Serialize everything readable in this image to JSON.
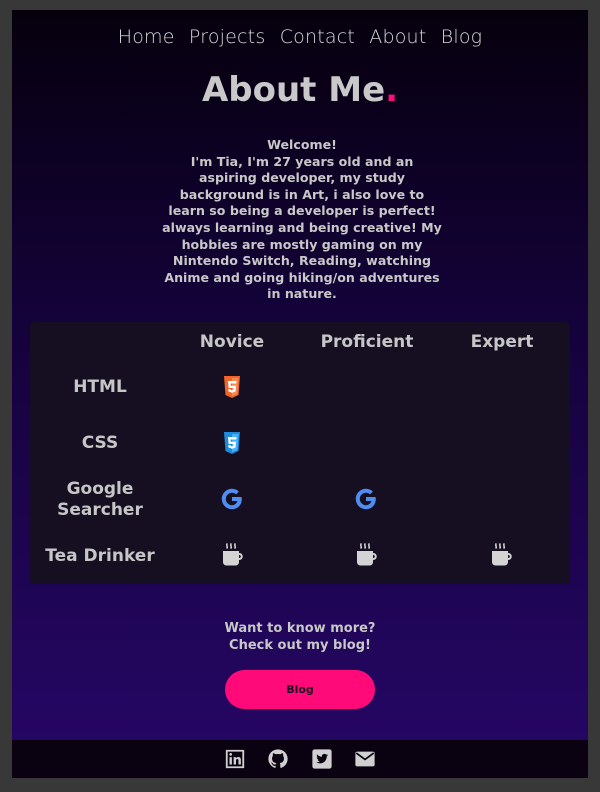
{
  "nav": {
    "items": [
      "Home",
      "Projects",
      "Contact",
      "About",
      "Blog"
    ]
  },
  "header": {
    "title": "About Me",
    "title_dot": "."
  },
  "intro": {
    "greeting": "Welcome!",
    "body": "I'm Tia, I'm 27 years old and an aspiring developer, my study background is in Art, i also love to learn so being a developer is perfect! always learning and being creative! My hobbies are mostly gaming on my Nintendo Switch, Reading, watching Anime and going hiking/on adventures in nature."
  },
  "skills": {
    "levels": [
      "Novice",
      "Proficient",
      "Expert"
    ],
    "rows": [
      {
        "label": "HTML",
        "icon": "html5-icon",
        "levels": [
          "Novice"
        ]
      },
      {
        "label": "CSS",
        "icon": "css3-icon",
        "levels": [
          "Novice"
        ]
      },
      {
        "label": "Google Searcher",
        "icon": "google-icon",
        "levels": [
          "Novice",
          "Proficient"
        ]
      },
      {
        "label": "Tea Drinker",
        "icon": "mug-icon",
        "levels": [
          "Novice",
          "Proficient",
          "Expert"
        ]
      }
    ]
  },
  "cta": {
    "line1": "Want to know more?",
    "line2": "Check out my blog!",
    "button_label": "Blog"
  },
  "footer": {
    "icons": [
      "linkedin-icon",
      "github-icon",
      "twitter-icon",
      "envelope-icon"
    ]
  },
  "colors": {
    "accent": "#ff0f7b",
    "text": "#c8c8c8",
    "panel": "#160f22",
    "gradient_top": "#06000d",
    "gradient_bottom": "#260767"
  }
}
